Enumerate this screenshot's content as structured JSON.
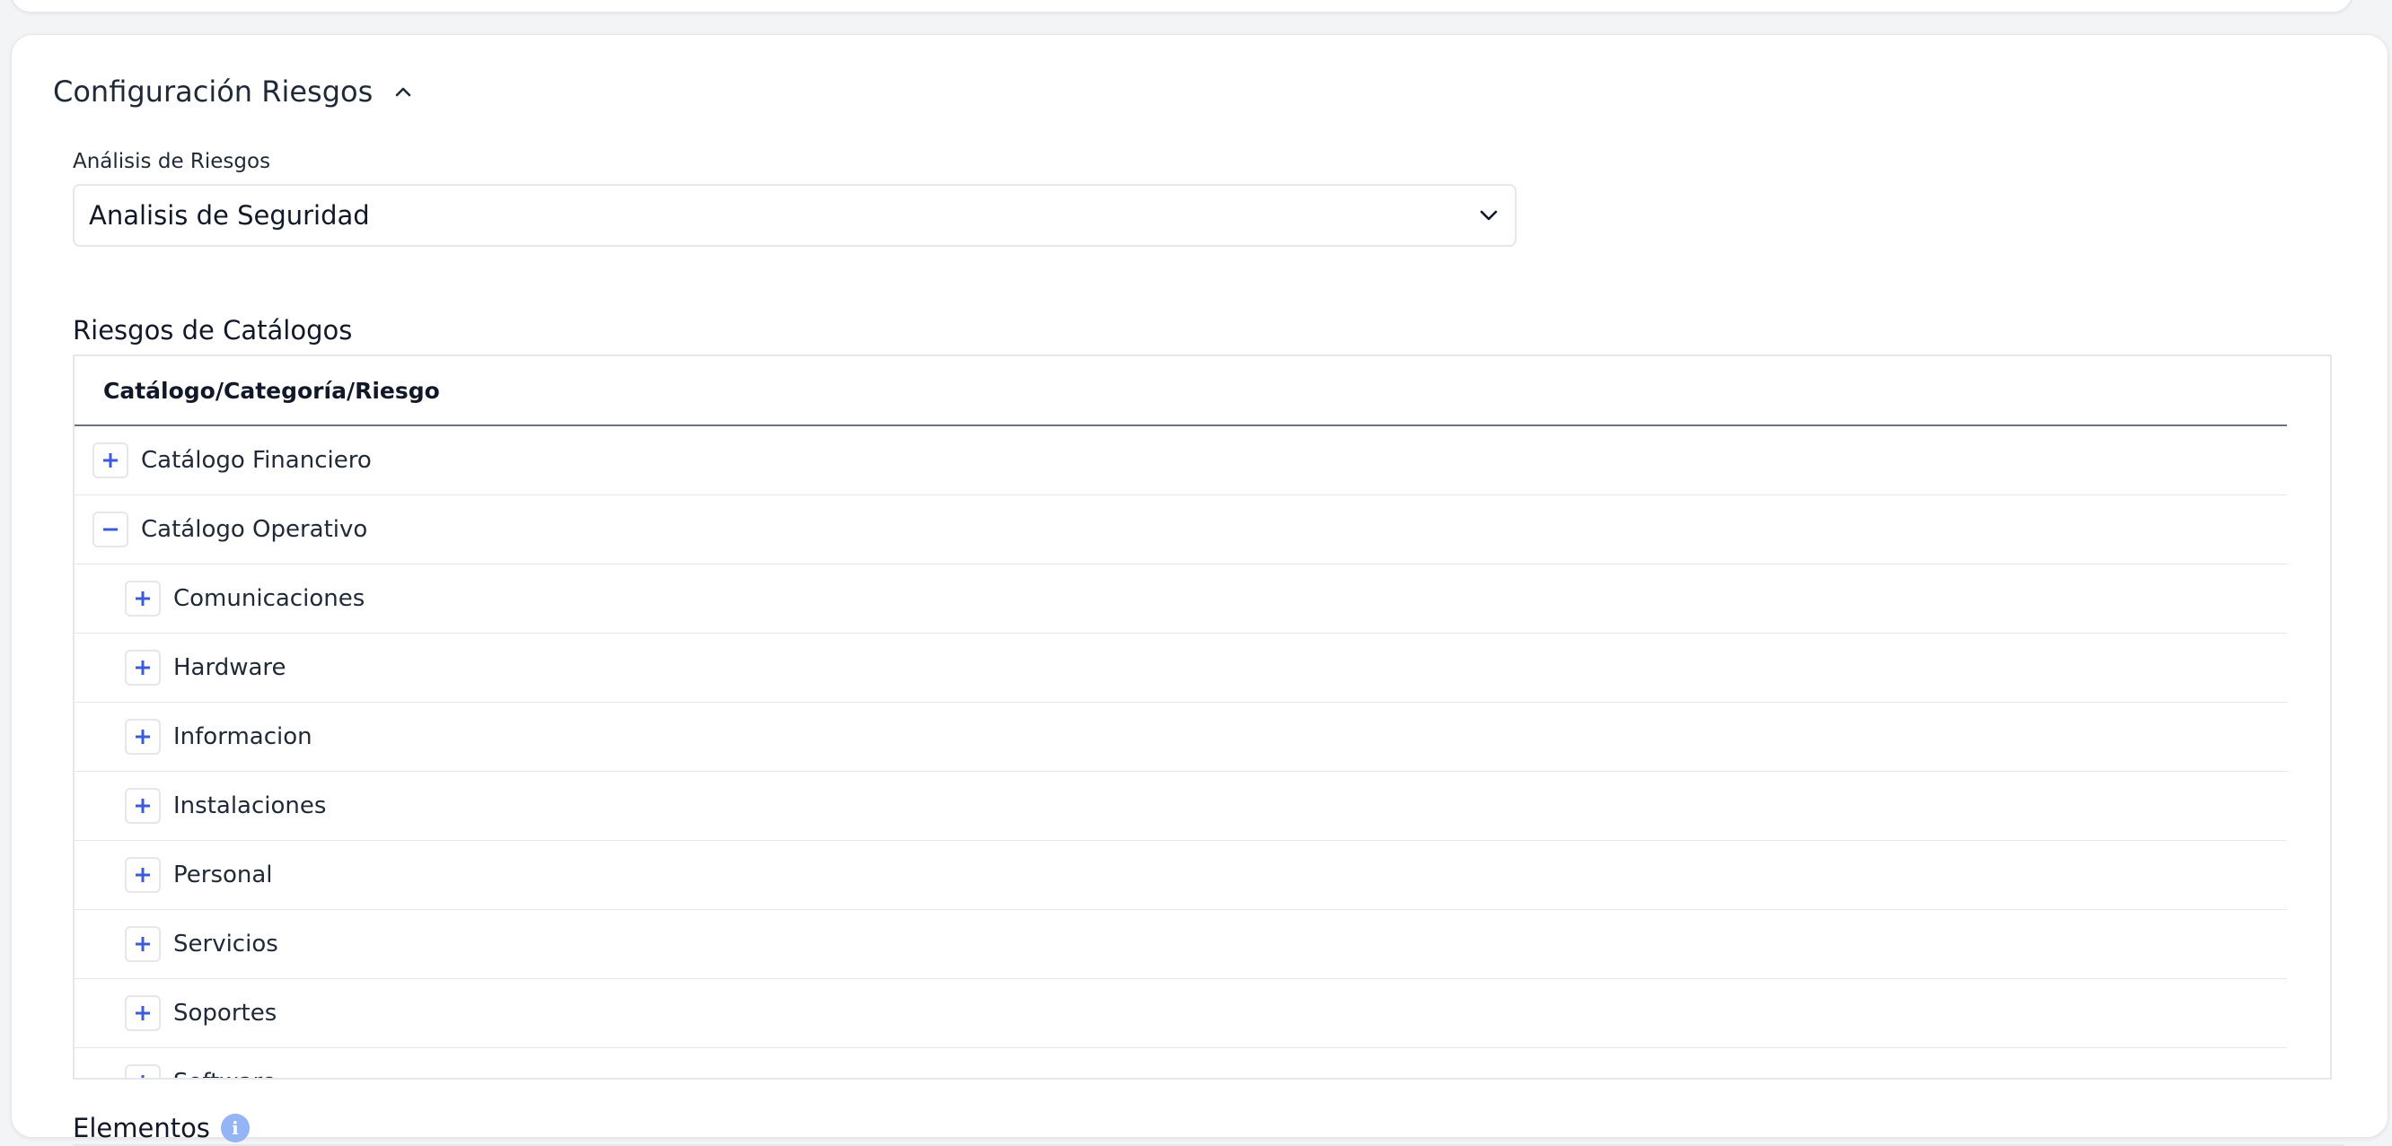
{
  "section": {
    "title": "Configuración Riesgos",
    "collapse_icon": "chevron-up-icon"
  },
  "analysis": {
    "label": "Análisis de Riesgos",
    "selected": "Analisis de Seguridad",
    "dropdown_icon": "chevron-down-icon"
  },
  "catalog": {
    "title": "Riesgos de Catálogos",
    "column_header": "Catálogo/Categoría/Riesgo",
    "rows": [
      {
        "label": "Catálogo Financiero",
        "level": 0,
        "expanded": false
      },
      {
        "label": "Catálogo Operativo",
        "level": 0,
        "expanded": true
      },
      {
        "label": "Comunicaciones",
        "level": 1,
        "expanded": false
      },
      {
        "label": "Hardware",
        "level": 1,
        "expanded": false
      },
      {
        "label": "Informacion",
        "level": 1,
        "expanded": false
      },
      {
        "label": "Instalaciones",
        "level": 1,
        "expanded": false
      },
      {
        "label": "Personal",
        "level": 1,
        "expanded": false
      },
      {
        "label": "Servicios",
        "level": 1,
        "expanded": false
      },
      {
        "label": "Soportes",
        "level": 1,
        "expanded": false
      },
      {
        "label": "Software",
        "level": 1,
        "expanded": false
      }
    ]
  },
  "elements": {
    "title": "Elementos",
    "info_icon_glyph": "i"
  },
  "colors": {
    "accent": "#3b5bdb",
    "info": "#93b4f5",
    "border": "#e5e7eb"
  }
}
